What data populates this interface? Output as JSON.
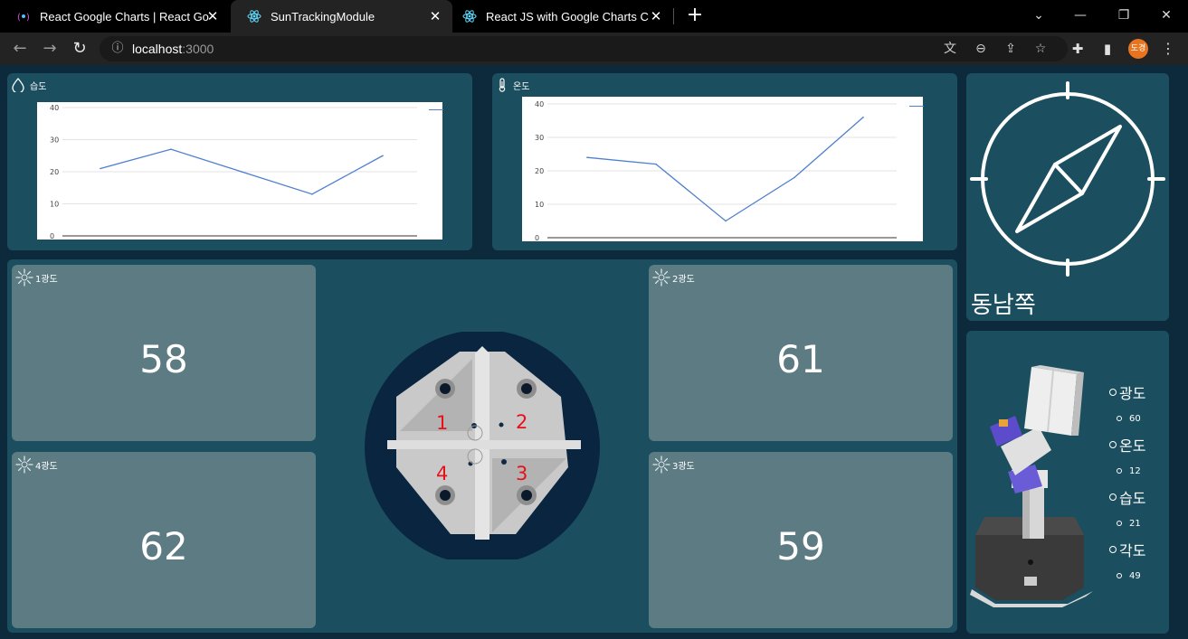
{
  "browser": {
    "tabs": [
      {
        "title": "React Google Charts | React Go",
        "icon": "react-google-charts-icon",
        "active": false
      },
      {
        "title": "SunTrackingModule",
        "icon": "react-icon",
        "active": true
      },
      {
        "title": "React JS with Google Charts Co",
        "icon": "react-icon",
        "active": false
      }
    ],
    "url_host": "localhost",
    "url_port": ":3000",
    "profile_initials": "도경"
  },
  "humidity_panel": {
    "label": "습도",
    "icon": "droplet-icon"
  },
  "temperature_panel": {
    "label": "온도",
    "icon": "thermometer-icon"
  },
  "compass": {
    "icon": "compass-icon",
    "direction": "동남쪽"
  },
  "sensors": [
    {
      "label": "1광도",
      "value": "58"
    },
    {
      "label": "2광도",
      "value": "61"
    },
    {
      "label": "4광도",
      "value": "62"
    },
    {
      "label": "3광도",
      "value": "59"
    }
  ],
  "module_image": {
    "quadrant_labels": [
      "1",
      "2",
      "4",
      "3"
    ],
    "label_color": "#e8101a"
  },
  "status": {
    "items": [
      {
        "label": "광도",
        "value": "60"
      },
      {
        "label": "온도",
        "value": "12"
      },
      {
        "label": "습도",
        "value": "21"
      },
      {
        "label": "각도",
        "value": "49"
      }
    ]
  },
  "colors": {
    "background": "#0d2a3c",
    "panel": "#1b4f5f",
    "card": "#5c7b83",
    "line": "#4f7fcf"
  },
  "chart_data": [
    {
      "type": "line",
      "title": "",
      "x": [
        1,
        2,
        3,
        4,
        5
      ],
      "series": [
        {
          "values": [
            21,
            27,
            20,
            13,
            25
          ]
        }
      ],
      "ylim": [
        0,
        40
      ],
      "yticks": [
        0,
        10,
        20,
        30,
        40
      ],
      "grid": true,
      "legend": "right"
    },
    {
      "type": "line",
      "title": "",
      "x": [
        1,
        2,
        3,
        4,
        5
      ],
      "series": [
        {
          "values": [
            24,
            22,
            5,
            18,
            36
          ]
        }
      ],
      "ylim": [
        0,
        40
      ],
      "yticks": [
        0,
        10,
        20,
        30,
        40
      ],
      "grid": true,
      "legend": "right"
    }
  ]
}
